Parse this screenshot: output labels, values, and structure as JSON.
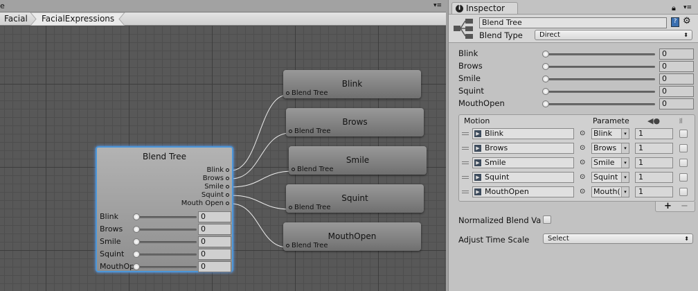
{
  "graph": {
    "topbar_fragment": "e",
    "breadcrumb": [
      "Facial",
      "FacialExpressions"
    ],
    "blend_tree_node": {
      "title": "Blend Tree",
      "outputs": [
        "Blink",
        "Brows",
        "Smile",
        "Squint",
        "Mouth Open"
      ],
      "params": [
        {
          "label": "Blink",
          "value": "0"
        },
        {
          "label": "Brows",
          "value": "0"
        },
        {
          "label": "Smile",
          "value": "0"
        },
        {
          "label": "Squint",
          "value": "0"
        },
        {
          "label": "MouthOpen",
          "value": "0"
        }
      ]
    },
    "child_nodes": [
      {
        "title": "Blink",
        "input": "Blend Tree"
      },
      {
        "title": "Brows",
        "input": "Blend Tree"
      },
      {
        "title": "Smile",
        "input": "Blend Tree"
      },
      {
        "title": "Squint",
        "input": "Blend Tree"
      },
      {
        "title": "MouthOpen",
        "input": "Blend Tree"
      }
    ]
  },
  "inspector": {
    "tab_label": "Inspector",
    "name_value": "Blend Tree",
    "blend_type_label": "Blend Type",
    "blend_type_value": "Direct",
    "params": [
      {
        "label": "Blink",
        "value": "0"
      },
      {
        "label": "Brows",
        "value": "0"
      },
      {
        "label": "Smile",
        "value": "0"
      },
      {
        "label": "Squint",
        "value": "0"
      },
      {
        "label": "MouthOpen",
        "value": "0"
      }
    ],
    "motion_list": {
      "headers": {
        "motion": "Motion",
        "parameter": "Paramete"
      },
      "rows": [
        {
          "motion": "Blink",
          "parameter": "Blink",
          "threshold": "1",
          "mirror": false
        },
        {
          "motion": "Brows",
          "parameter": "Brows",
          "threshold": "1",
          "mirror": false
        },
        {
          "motion": "Smile",
          "parameter": "Smile",
          "threshold": "1",
          "mirror": false
        },
        {
          "motion": "Squint",
          "parameter": "Squint",
          "threshold": "1",
          "mirror": false
        },
        {
          "motion": "MouthOpen",
          "parameter": "Mouth(",
          "threshold": "1",
          "mirror": false
        }
      ],
      "add_label": "+",
      "remove_label": "−"
    },
    "normalized_label": "Normalized Blend Va",
    "normalized_checked": false,
    "adjust_time_label": "Adjust Time Scale",
    "adjust_time_value": "Select"
  },
  "colors": {
    "selection": "#4c96d8",
    "grid": "#585858",
    "panel": "#c2c2c2"
  }
}
